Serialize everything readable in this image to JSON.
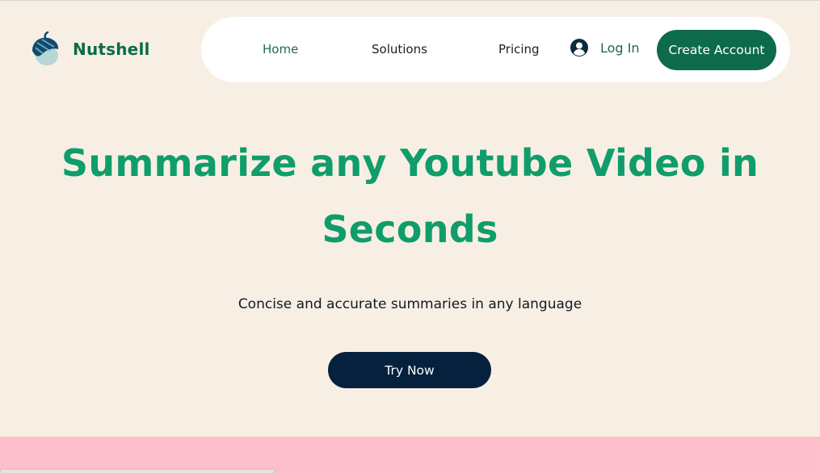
{
  "brand": {
    "name": "Nutshell",
    "icon": "acorn-icon",
    "color": "#0d6b4a"
  },
  "nav": {
    "links": [
      {
        "label": "Home"
      },
      {
        "label": "Solutions"
      },
      {
        "label": "Pricing"
      }
    ],
    "login": {
      "label": "Log In",
      "icon": "user-circle-icon"
    },
    "create_account": {
      "label": "Create Account"
    }
  },
  "hero": {
    "headline_line1": "Summarize any Youtube Video in",
    "headline_line2": "Seconds",
    "subtitle": "Concise and accurate summaries in any language",
    "cta": "Try Now"
  },
  "colors": {
    "background": "#f8efe4",
    "accent_green": "#0f9d6b",
    "dark_green": "#0d6b4a",
    "navy": "#06213e",
    "pink_band": "#fcbfcb"
  }
}
